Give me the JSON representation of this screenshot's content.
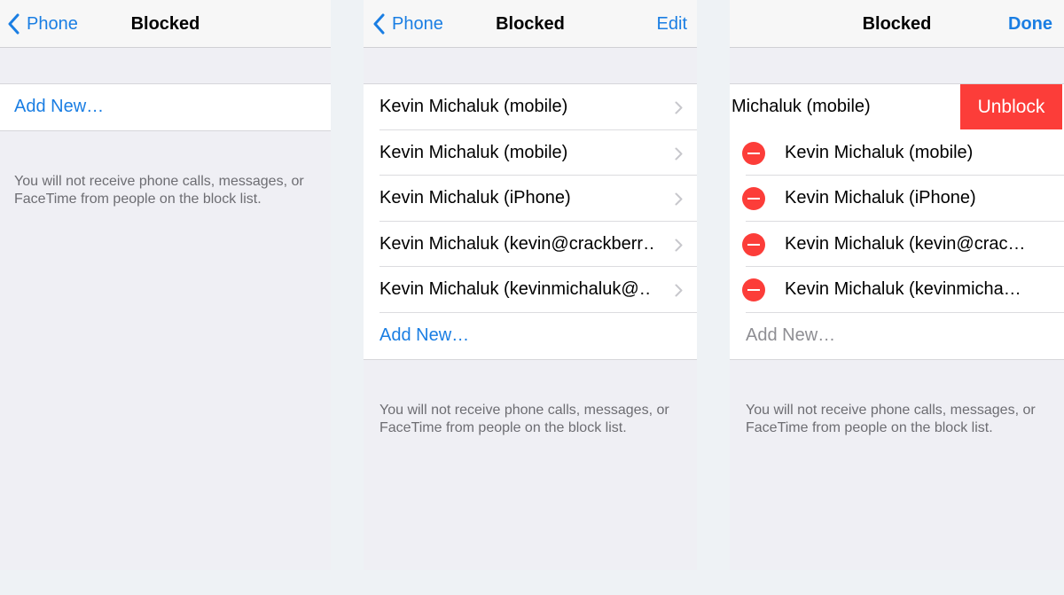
{
  "panels": [
    {
      "back_label": "Phone",
      "title": "Blocked",
      "rows": [
        {
          "label": "Add New…"
        }
      ],
      "footer": "You will not receive phone calls, messages, or FaceTime from people on the block list."
    },
    {
      "back_label": "Phone",
      "title": "Blocked",
      "right_action": "Edit",
      "rows": [
        {
          "label": "Kevin Michaluk (mobile)"
        },
        {
          "label": "Kevin Michaluk (mobile)"
        },
        {
          "label": "Kevin Michaluk (iPhone)"
        },
        {
          "label": "Kevin Michaluk (kevin@crackberr…"
        },
        {
          "label": "Kevin Michaluk (kevinmichaluk@…"
        },
        {
          "label": "Add New…"
        }
      ],
      "footer": "You will not receive phone calls, messages, or FaceTime from people on the block list."
    },
    {
      "title": "Blocked",
      "right_action": "Done",
      "swiped_row_label": "Michaluk (mobile)",
      "unblock_label": "Unblock",
      "rows": [
        {
          "label": "Kevin Michaluk (mobile)"
        },
        {
          "label": "Kevin Michaluk (iPhone)"
        },
        {
          "label": "Kevin Michaluk (kevin@crac…"
        },
        {
          "label": "Kevin Michaluk (kevinmicha…"
        },
        {
          "label": "Add New…"
        }
      ],
      "footer": "You will not receive phone calls, messages, or FaceTime from people on the block list."
    }
  ],
  "icons": {
    "back": "chevron-left-icon",
    "disclosure": "chevron-right-icon",
    "delete": "delete-minus-icon"
  },
  "colors": {
    "accent": "#1a7ee3",
    "destructive": "#fc3d39",
    "background": "#efeff4"
  }
}
